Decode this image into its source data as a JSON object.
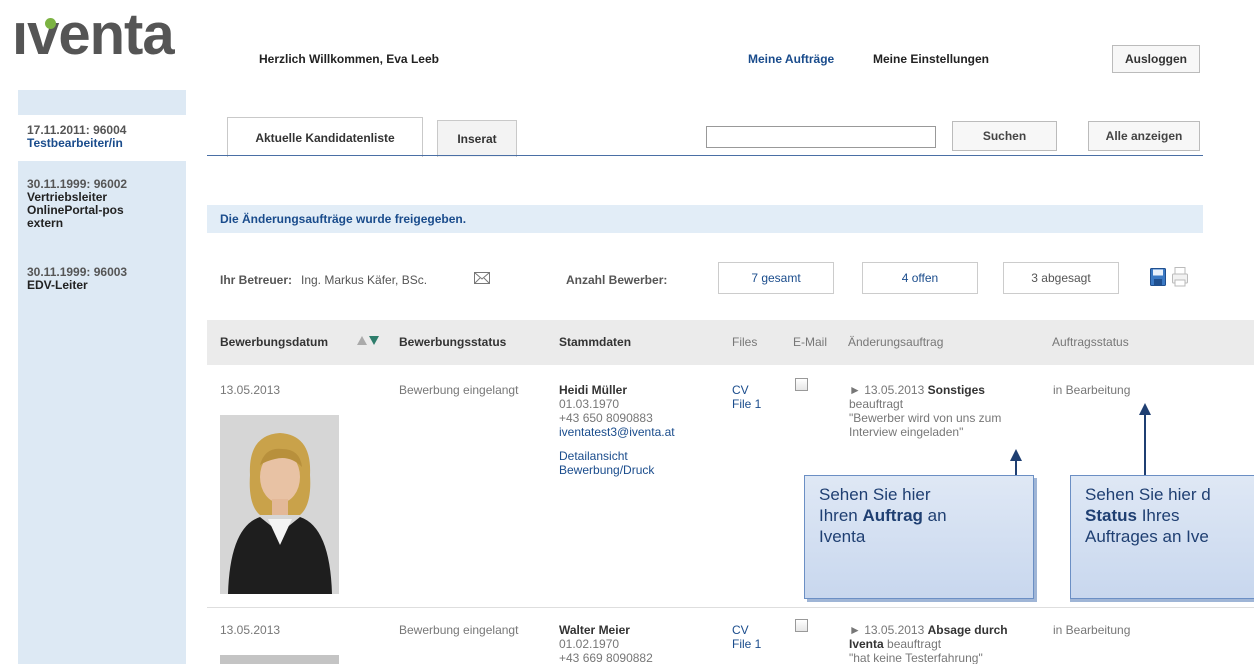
{
  "header": {
    "logo_text": "ıventa",
    "welcome": "Herzlich Willkommen, Eva Leeb",
    "nav_auftraege": "Meine Aufträge",
    "nav_settings": "Meine Einstellungen",
    "logout": "Ausloggen",
    "brand_color": "#1a4c8c",
    "logo_dot_color": "#7cb342"
  },
  "sidebar": {
    "items": [
      {
        "date": "17.11.2011: 96004",
        "title": "Testbearbeiter/in",
        "active": true
      },
      {
        "date": "30.11.1999: 96002",
        "title": "Vertriebsleiter OnlinePortal-pos extern",
        "active": false
      },
      {
        "date": "30.11.1999: 96003",
        "title": "EDV-Leiter",
        "active": false
      }
    ]
  },
  "tabs": [
    {
      "label": "Aktuelle Kandidatenliste",
      "active": true
    },
    {
      "label": "Inserat",
      "active": false
    }
  ],
  "search": {
    "value": "",
    "button": "Suchen",
    "show_all": "Alle anzeigen"
  },
  "notice": "Die Änderungsaufträge wurde freigegeben.",
  "info": {
    "betreuer_label": "Ihr Betreuer:",
    "betreuer_value": "Ing. Markus Käfer, BSc.",
    "anzahl_label": "Anzahl Bewerber:",
    "counts": [
      "7 gesamt",
      "4 offen",
      "3 abgesagt"
    ]
  },
  "table": {
    "headers": [
      "Bewerbungsdatum",
      "Bewerbungsstatus",
      "Stammdaten",
      "Files",
      "E-Mail",
      "Änderungsauftrag",
      "Auftragsstatus"
    ],
    "rows": [
      {
        "date": "13.05.2013",
        "status": "Bewerbung eingelangt",
        "name": "Heidi Müller",
        "birth": "01.03.1970",
        "phone": "+43 650 8090883",
        "email": "iventatest3@iventa.at",
        "link1": "Detailansicht",
        "link2": "Bewerbung/Druck",
        "files": [
          "CV",
          "File 1"
        ],
        "order_date": "► 13.05.2013",
        "order_type": "Sonstiges",
        "order_state": "beauftragt",
        "order_note": "\"Bewerber wird von uns zum Interview eingeladen\"",
        "auftragsstatus": "in Bearbeitung"
      },
      {
        "date": "13.05.2013",
        "status": "Bewerbung eingelangt",
        "name": "Walter Meier",
        "birth": "01.02.1970",
        "phone": "+43 669 8090882",
        "files": [
          "CV",
          "File 1"
        ],
        "order_date": "► 13.05.2013",
        "order_type": "Absage durch",
        "order_by": "Iventa",
        "order_state": "beauftragt",
        "order_note": "\"hat keine Testerfahrung\"",
        "auftragsstatus": "in Bearbeitung"
      }
    ]
  },
  "callouts": {
    "auftrag": {
      "line1": "Sehen Sie hier",
      "line2_pre": "Ihren ",
      "line2_bold": "Auftrag",
      "line2_post": " an",
      "line3": "Iventa"
    },
    "status": {
      "line1": "Sehen Sie hier d",
      "line2_bold": "Status",
      "line2_post": " Ihres",
      "line3": "Auftrages an Ive"
    }
  }
}
